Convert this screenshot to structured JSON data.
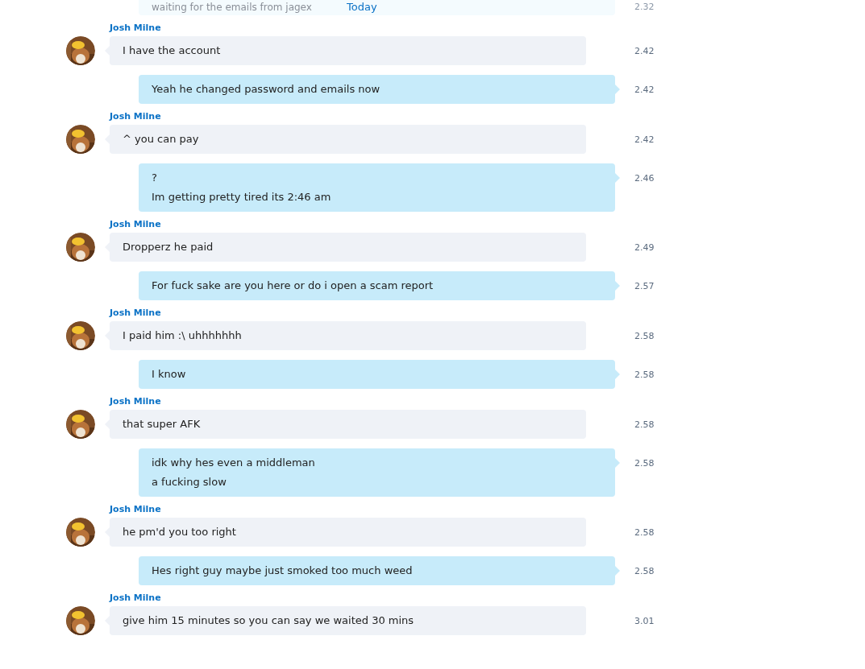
{
  "divider": {
    "label": "Today"
  },
  "faded_message": {
    "kind": "outgoing",
    "lines": [
      "waiting for the emails from jagex"
    ],
    "time": "2.32"
  },
  "messages": [
    {
      "kind": "incoming",
      "sender": "Josh Milne",
      "lines": [
        "I have the account"
      ],
      "time": "2.42"
    },
    {
      "kind": "outgoing",
      "lines": [
        "Yeah he changed password and emails now"
      ],
      "time": "2.42"
    },
    {
      "kind": "incoming",
      "sender": "Josh Milne",
      "lines": [
        "^ you can pay"
      ],
      "time": "2.42"
    },
    {
      "kind": "outgoing",
      "lines": [
        "?",
        "Im getting pretty tired its 2:46 am"
      ],
      "time": "2.46"
    },
    {
      "kind": "incoming",
      "sender": "Josh Milne",
      "lines": [
        "Dropperz he paid"
      ],
      "time": "2.49"
    },
    {
      "kind": "outgoing",
      "lines": [
        "For fuck sake are you here or do i open a scam report"
      ],
      "time": "2.57"
    },
    {
      "kind": "incoming",
      "sender": "Josh Milne",
      "lines": [
        "I paid him :\\ uhhhhhhh"
      ],
      "time": "2.58"
    },
    {
      "kind": "outgoing",
      "lines": [
        "I know"
      ],
      "time": "2.58"
    },
    {
      "kind": "incoming",
      "sender": "Josh Milne",
      "lines": [
        "that super AFK"
      ],
      "time": "2.58"
    },
    {
      "kind": "outgoing",
      "lines": [
        "idk why hes even a middleman",
        "a fucking slow"
      ],
      "time": "2.58"
    },
    {
      "kind": "incoming",
      "sender": "Josh Milne",
      "lines": [
        "he pm'd you too right"
      ],
      "time": "2.58"
    },
    {
      "kind": "outgoing",
      "lines": [
        "Hes right guy maybe just smoked too much weed"
      ],
      "time": "2.58"
    },
    {
      "kind": "incoming",
      "sender": "Josh Milne",
      "lines": [
        "give him 15 minutes so you can say we waited 30 mins"
      ],
      "time": "3.01"
    }
  ]
}
